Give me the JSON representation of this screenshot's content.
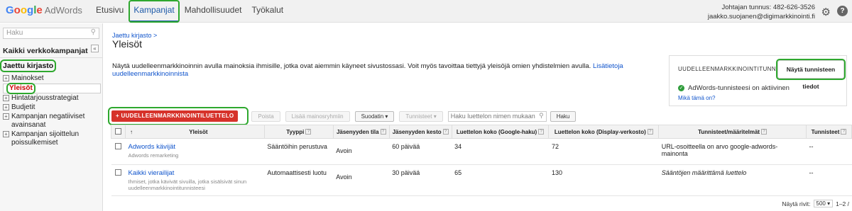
{
  "header": {
    "logo_google": [
      "G",
      "o",
      "o",
      "g",
      "l",
      "e"
    ],
    "logo_product": "AdWords",
    "nav": [
      "Etusivu",
      "Kampanjat",
      "Mahdollisuudet",
      "Työkalut"
    ],
    "account_id": "Johtajan tunnus: 482-626-3526",
    "account_email": "jaakko.suojanen@digimarkkinointi.fi"
  },
  "sidebar": {
    "search_placeholder": "Haku",
    "all_campaigns": "Kaikki verkkokampanjat",
    "collapse_glyph": "«",
    "library": "Jaettu kirjasto",
    "items": [
      "Mainokset",
      "Yleisöt",
      "Hintatarjousstrategiat",
      "Budjetit",
      "Kampanjan negatiiviset avainsanat",
      "Kampanjan sijoittelun poissulkemiset"
    ]
  },
  "main": {
    "breadcrumb": "Jaettu kirjasto >",
    "title": "Yleisöt",
    "description": "Näytä uudelleenmarkkinoinnin avulla mainoksia ihmisille, jotka ovat aiemmin käyneet sivustossasi. Voit myös tavoittaa tiettyjä yleisöjä omien yhdistelmien avulla. ",
    "description_link": "Lisätietoja uudelleenmarkkinoinnista",
    "tagbox": {
      "heading": "UUDELLEENMARKKINOINTITUNNISTE",
      "button": "Näytä tunnisteen tiedot",
      "status": "AdWords-tunnisteesi on aktiivinen",
      "link": "Mikä tämä on?"
    },
    "toolbar": {
      "new_list": "+ UUDELLEENMARKKINOINTILUETTELO",
      "remove": "Poista",
      "add_to_ad_group": "Lisää mainosryhmiin",
      "filter": "Suodatin ▾",
      "tags": "Tunnisteet ▾",
      "search_placeholder": "Haku luettelon nimen mukaan",
      "search_button": "Haku"
    },
    "table": {
      "headers": [
        "Yleisöt",
        "Tyyppi",
        "Jäsenyyden tila",
        "Jäsenyyden kesto",
        "Luettelon koko (Google-haku)",
        "Luettelon koko (Display-verkosto)",
        "Tunnisteet/määritelmät",
        "Tunnisteet"
      ],
      "sort_arrow": "↑",
      "rows": [
        {
          "name": "Adwords kävijät",
          "sub": "Adwords remarketing",
          "type": "Sääntöihin perustuva",
          "status": "Avoin",
          "duration": "60 päivää",
          "search_size": "34",
          "display_size": "72",
          "definition": "URL-osoitteella on arvo google-adwords-mainonta",
          "tags": "--"
        },
        {
          "name": "Kaikki vierailijat",
          "sub": "Ihmiset, jotka kävivät sivuilla, jotka sisälsivät sinun uudelleenmarkkinointitunnisteesi",
          "type": "Automaattisesti luotu",
          "status": "Avoin",
          "duration": "30 päivää",
          "search_size": "65",
          "display_size": "130",
          "definition": "Sääntöjen määrittämä luettelo",
          "tags": "--"
        }
      ]
    },
    "footer": {
      "rows_label": "Näytä rivit:",
      "rows_value": "500 ▾",
      "range": "1–2 /"
    }
  }
}
